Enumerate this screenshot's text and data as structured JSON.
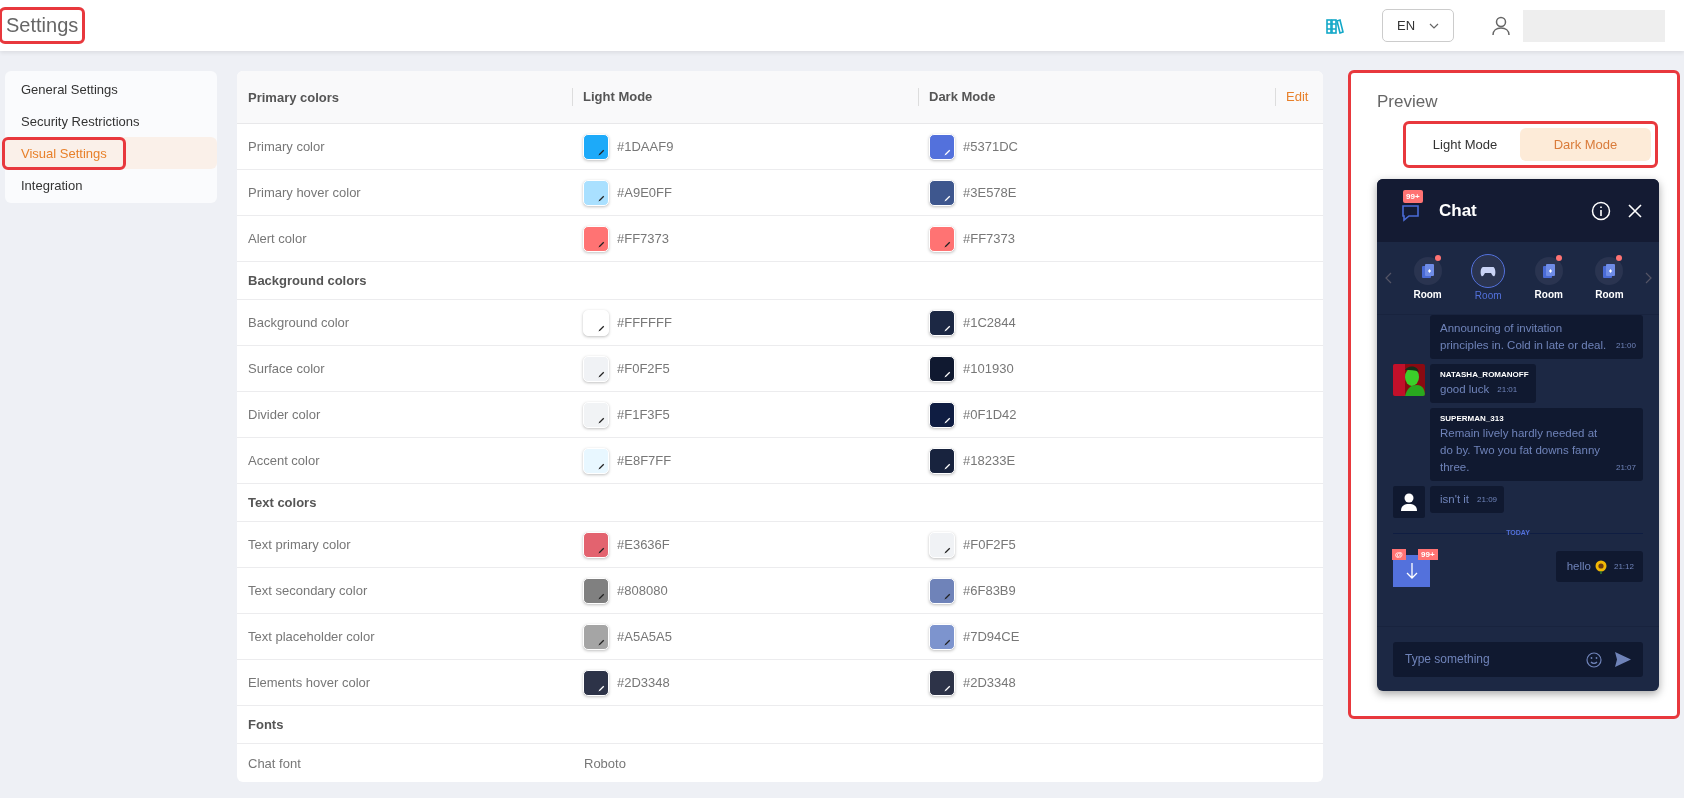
{
  "header": {
    "title": {
      "text": "Settings",
      "highlighted": true
    },
    "language": "EN"
  },
  "sidebar": {
    "items": [
      {
        "label": "General Settings",
        "selected": false,
        "highlighted": false
      },
      {
        "label": "Security Restrictions",
        "selected": false,
        "highlighted": false
      },
      {
        "label": "Visual Settings",
        "selected": true,
        "highlighted": true
      },
      {
        "label": "Integration",
        "selected": false,
        "highlighted": false
      }
    ]
  },
  "table": {
    "columns": [
      "Primary colors",
      "Light Mode",
      "Dark Mode"
    ],
    "edit": "Edit",
    "rows": [
      {
        "kind": "color",
        "label": "Primary color",
        "light": {
          "hex": "#1DAAF9",
          "color": "#1daaf9"
        },
        "dark": {
          "hex": "#5371DC",
          "color": "#5371dc"
        }
      },
      {
        "kind": "color",
        "label": "Primary hover color",
        "light": {
          "hex": "#A9E0FF",
          "color": "#a9e0ff"
        },
        "dark": {
          "hex": "#3E578E",
          "color": "#3e578e"
        }
      },
      {
        "kind": "color",
        "label": "Alert color",
        "light": {
          "hex": "#FF7373",
          "color": "#ff7373"
        },
        "dark": {
          "hex": "#FF7373",
          "color": "#ff7373"
        }
      },
      {
        "kind": "section",
        "label": "Background colors"
      },
      {
        "kind": "color",
        "label": "Background color",
        "light": {
          "hex": "#FFFFFF",
          "color": "#ffffff"
        },
        "dark": {
          "hex": "#1C2844",
          "color": "#1c2844"
        }
      },
      {
        "kind": "color",
        "label": "Surface color",
        "light": {
          "hex": "#F0F2F5",
          "color": "#f0f2f5"
        },
        "dark": {
          "hex": "#101930",
          "color": "#101930"
        }
      },
      {
        "kind": "color",
        "label": "Divider color",
        "light": {
          "hex": "#F1F3F5",
          "color": "#f1f3f5"
        },
        "dark": {
          "hex": "#0F1D42",
          "color": "#0f1d42"
        }
      },
      {
        "kind": "color",
        "label": "Accent color",
        "light": {
          "hex": "#E8F7FF",
          "color": "#e8f7ff"
        },
        "dark": {
          "hex": "#18233E",
          "color": "#18233e"
        }
      },
      {
        "kind": "section",
        "label": "Text colors"
      },
      {
        "kind": "color",
        "label": "Text primary color",
        "light": {
          "hex": "#E3636F",
          "color": "#e3636f"
        },
        "dark": {
          "hex": "#F0F2F5",
          "color": "#f0f2f5"
        }
      },
      {
        "kind": "color",
        "label": "Text secondary color",
        "light": {
          "hex": "#808080",
          "color": "#808080"
        },
        "dark": {
          "hex": "#6F83B9",
          "color": "#6f83b9"
        }
      },
      {
        "kind": "color",
        "label": "Text placeholder color",
        "light": {
          "hex": "#A5A5A5",
          "color": "#a5a5a5"
        },
        "dark": {
          "hex": "#7D94CE",
          "color": "#7d94ce"
        }
      },
      {
        "kind": "color",
        "label": "Elements hover color",
        "light": {
          "hex": "#2D3348",
          "color": "#2d3348"
        },
        "dark": {
          "hex": "#2D3348",
          "color": "#2d3348"
        }
      },
      {
        "kind": "section",
        "label": "Fonts"
      },
      {
        "kind": "text",
        "label": "Chat font",
        "value": "Roboto"
      }
    ]
  },
  "preview": {
    "title": "Preview",
    "highlighted": true,
    "modes_highlighted": true,
    "modes": [
      {
        "label": "Light Mode",
        "selected": false
      },
      {
        "label": "Dark Mode",
        "selected": true
      }
    ],
    "chat": {
      "title": "Chat",
      "badge": "99+",
      "rooms": [
        {
          "label": "Room",
          "selected": false,
          "unread": true
        },
        {
          "label": "Room",
          "selected": true,
          "unread": false
        },
        {
          "label": "Room",
          "selected": false,
          "unread": true
        },
        {
          "label": "Room",
          "selected": false,
          "unread": true
        }
      ],
      "messages": [
        {
          "kind": "message",
          "text": "Announcing of invitation principles in. Cold in late or deal.",
          "time": "21:00"
        },
        {
          "kind": "message",
          "author": "NATASHA_ROMANOFF",
          "text": "good luck",
          "time": "21:01"
        },
        {
          "kind": "message",
          "author": "SUPERMAN_313",
          "text": "Remain lively hardly needed at do by. Two you fat downs fanny three.",
          "time": "21:07"
        },
        {
          "kind": "message",
          "text": "isn't it",
          "time": "21:09",
          "avatar": {
            "kind": "person"
          }
        },
        {
          "kind": "divider",
          "label": "TODAY"
        },
        {
          "kind": "own",
          "text": "hello",
          "time": "21:12"
        }
      ],
      "jump": {
        "mention": "@",
        "badge": "99+"
      },
      "input": {
        "placeholder": "Type something"
      }
    }
  }
}
